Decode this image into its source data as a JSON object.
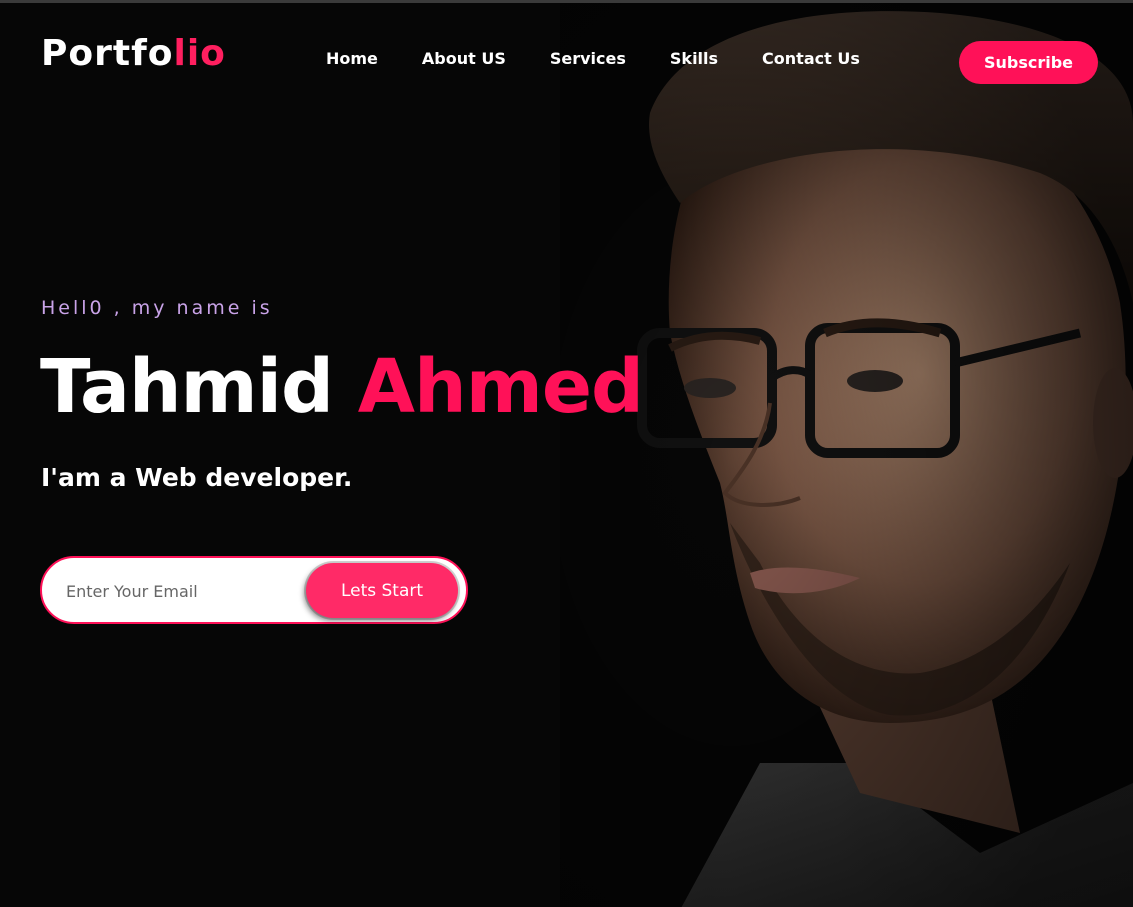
{
  "brand": {
    "logo_main": "Portfo",
    "logo_accent": "lio",
    "accent_color": "#ff1158"
  },
  "nav": {
    "home": "Home",
    "about": "About US",
    "services": "Services",
    "skills": "Skills",
    "contact": "Contact Us",
    "subscribe": "Subscribe"
  },
  "hero": {
    "greeting": "Hell0 , my name is",
    "first_name": "Tahmid",
    "last_name": "Ahmed",
    "tagline": "I'am a Web developer."
  },
  "form": {
    "email_placeholder": "Enter Your Email",
    "email_value": "",
    "submit_label": "Lets Start"
  },
  "colors": {
    "background": "#060606",
    "greeting_text": "#c9a3e8",
    "button": "#ff1158"
  }
}
